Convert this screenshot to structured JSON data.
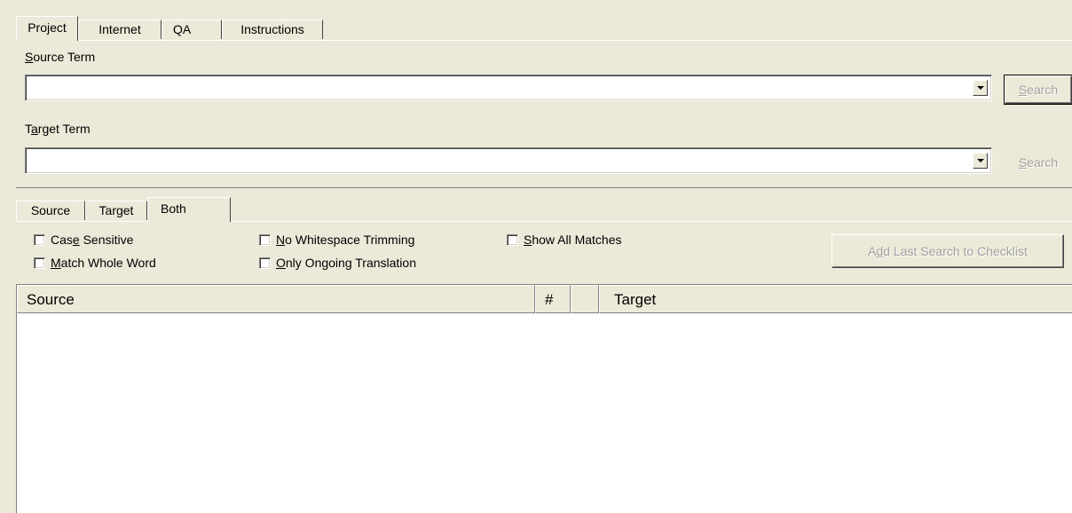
{
  "main_tabs": [
    {
      "label": "Project",
      "active": true
    },
    {
      "label": "Internet",
      "active": false
    },
    {
      "label": "QA",
      "active": false
    },
    {
      "label": "Instructions",
      "active": false
    }
  ],
  "source_term": {
    "label_pre": "",
    "label_key": "S",
    "label_post": "ource Term",
    "value": "",
    "search_key": "S",
    "search_rest": "earch"
  },
  "target_term": {
    "label_pre": "T",
    "label_key": "a",
    "label_post": "rget Term",
    "value": "",
    "search_key": "S",
    "search_rest": "earch"
  },
  "scope_tabs": [
    {
      "label": "Source",
      "active": false
    },
    {
      "label": "Target",
      "active": false
    },
    {
      "label": "Both",
      "active": true
    }
  ],
  "options": {
    "case_sensitive": {
      "pre": "Cas",
      "key": "e",
      "post": " Sensitive",
      "checked": false
    },
    "match_whole_word": {
      "pre": "",
      "key": "M",
      "post": "atch Whole Word",
      "checked": false
    },
    "no_whitespace_trimming": {
      "pre": "",
      "key": "N",
      "post": "o Whitespace Trimming",
      "checked": false
    },
    "only_ongoing_translation": {
      "pre": "",
      "key": "O",
      "post": "nly Ongoing Translation",
      "checked": false
    },
    "show_all_matches": {
      "pre": "",
      "key": "S",
      "post": "how All Matches",
      "checked": false
    }
  },
  "add_checklist": {
    "pre": "A",
    "key": "d",
    "post": "d Last Search to Checklist"
  },
  "results_table": {
    "columns": [
      "Source",
      "#",
      "",
      "Target"
    ],
    "rows": []
  }
}
